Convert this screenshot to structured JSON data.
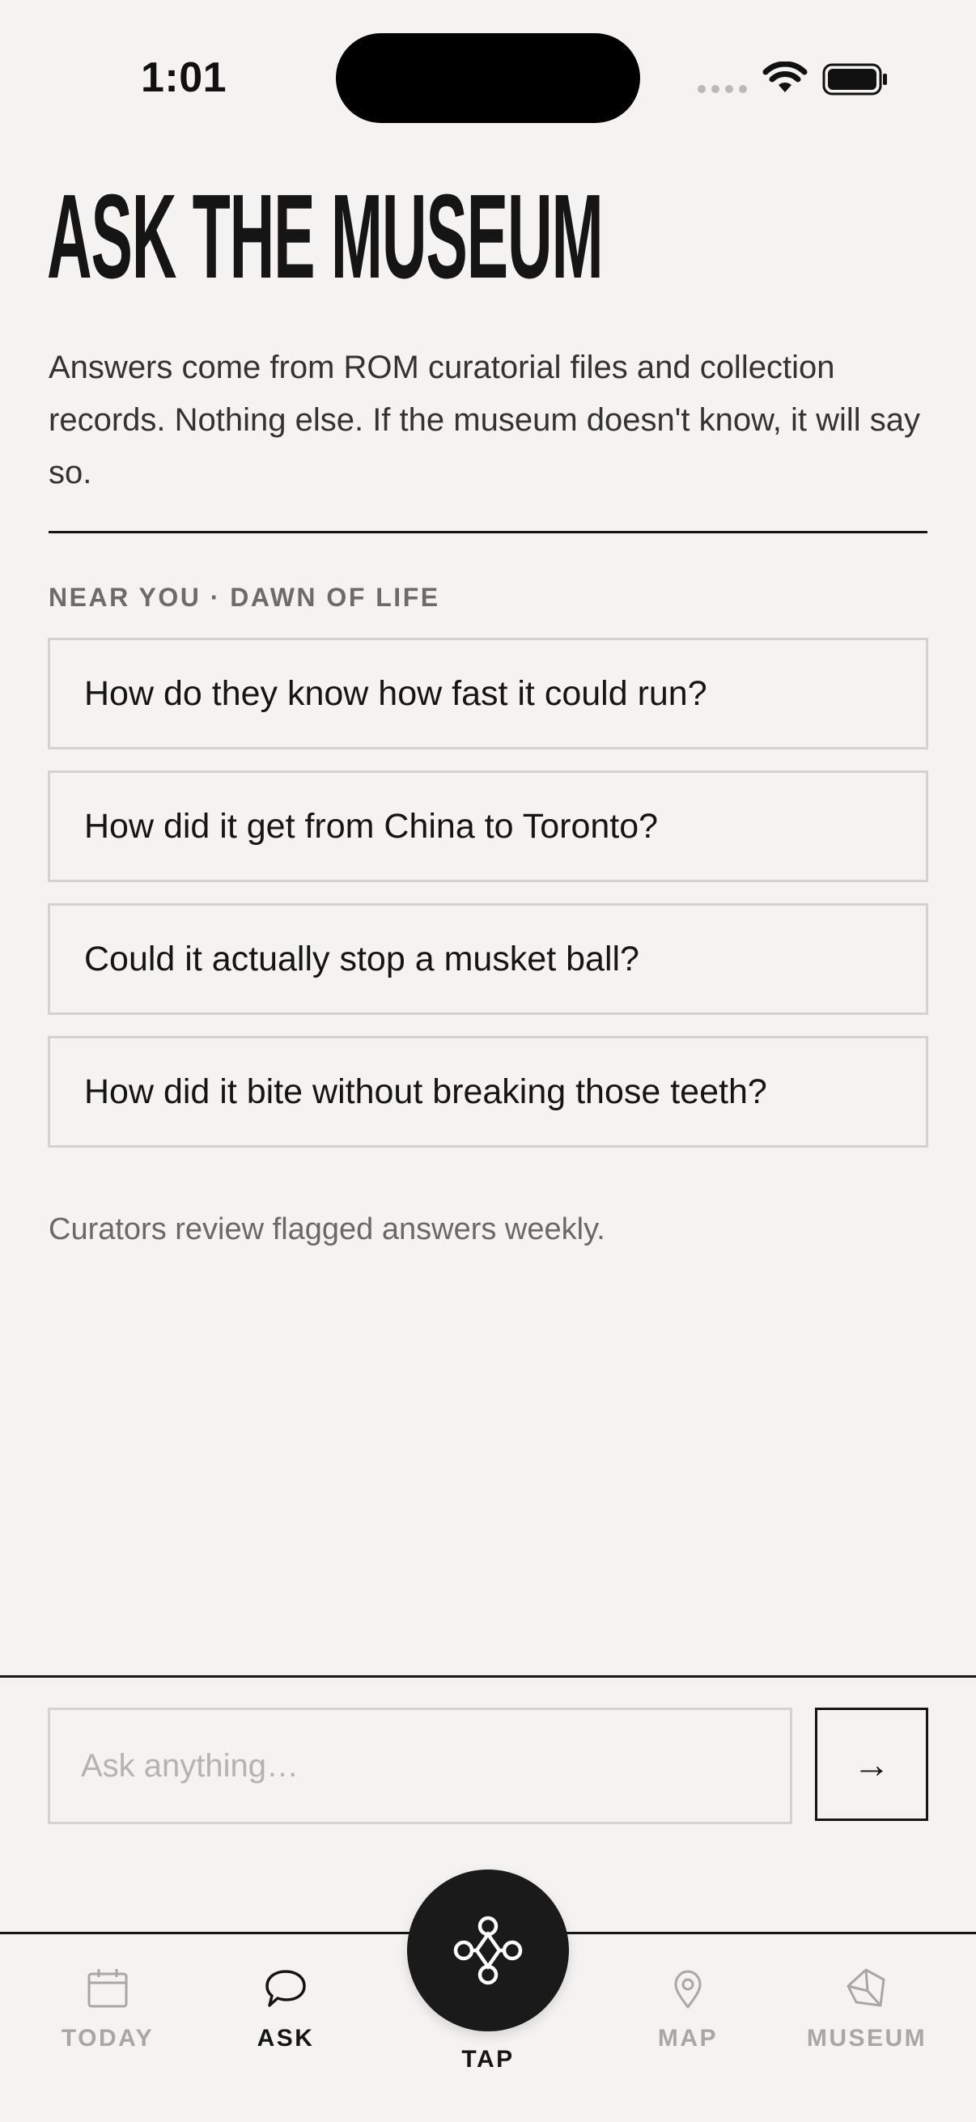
{
  "status_bar": {
    "time": "1:01"
  },
  "header": {
    "title": "ASK THE MUSEUM",
    "intro": "Answers come from ROM curatorial files and collection records. Nothing else. If the museum doesn't know, it will say so."
  },
  "suggestions": {
    "section_label": "NEAR YOU · DAWN OF LIFE",
    "items": [
      {
        "label": "How do they know how fast it could run?"
      },
      {
        "label": "How did it get from China to Toronto?"
      },
      {
        "label": "Could it actually stop a musket ball?"
      },
      {
        "label": "How did it bite without breaking those teeth?"
      }
    ]
  },
  "footnote": "Curators review flagged answers weekly.",
  "composer": {
    "placeholder": "Ask anything…",
    "send_icon": "→"
  },
  "tabbar": {
    "tabs": [
      {
        "label": "TODAY",
        "icon": "calendar-icon",
        "active": false
      },
      {
        "label": "ASK",
        "icon": "speech-bubble-icon",
        "active": true
      },
      {
        "label": "TAP",
        "icon": "quatrefoil-icon",
        "active": false
      },
      {
        "label": "MAP",
        "icon": "map-pin-icon",
        "active": false
      },
      {
        "label": "MUSEUM",
        "icon": "crystal-icon",
        "active": false
      }
    ]
  },
  "colors": {
    "background": "#f4f3f1",
    "ink": "#151515",
    "muted": "#6c6b68",
    "border": "#d3d2cf",
    "inactive_tab": "#a8a7a4"
  }
}
